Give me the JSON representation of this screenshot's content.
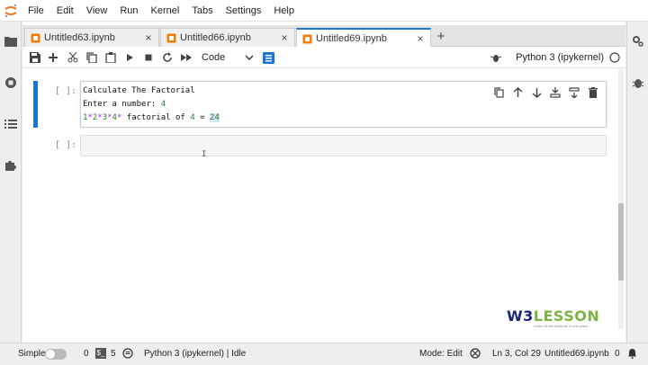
{
  "menubar": {
    "items": [
      "File",
      "Edit",
      "View",
      "Run",
      "Kernel",
      "Tabs",
      "Settings",
      "Help"
    ]
  },
  "tabs": [
    {
      "label": "Untitled63.ipynb",
      "close": "×"
    },
    {
      "label": "Untitled66.ipynb",
      "close": "×"
    },
    {
      "label": "Untitled69.ipynb",
      "close": "×"
    }
  ],
  "new_tab": "+",
  "toolbar": {
    "cell_type": "Code",
    "kernel_name": "Python 3 (ipykernel)"
  },
  "cells": [
    {
      "prompt": "[ ]:",
      "lines": {
        "line1": "Calculate The Factorial",
        "line2_text": "Enter a number: ",
        "line2_num": "4",
        "line3": {
          "n1": "1",
          "s1": "*",
          "n2": "2",
          "s2": "*",
          "n3": "3",
          "s3": "*",
          "n4": "4",
          "s4": "*",
          "mid": " factorial of ",
          "n5": "4",
          "eq": " = ",
          "result": "24"
        }
      }
    },
    {
      "prompt": "[ ]:"
    }
  ],
  "cursor_glyph": "I",
  "watermark": {
    "w3": "W3",
    "lesson": "LESSON",
    "tagline": "Learn all the subjects in one place"
  },
  "statusbar": {
    "mode_label": "Simple",
    "terminals": "0",
    "terminal_icon": "$_",
    "kernels": "5",
    "kernel_status": "Python 3 (ipykernel) | Idle",
    "mode": "Mode: Edit",
    "position": "Ln 3, Col 29",
    "filename": "Untitled69.ipynb",
    "notifications": "0"
  },
  "colors": {
    "accent": "#1976d2",
    "number_green": "#2e7d32",
    "operator_purple": "#aa22ff",
    "tab_icon_orange": "#f57c00"
  }
}
